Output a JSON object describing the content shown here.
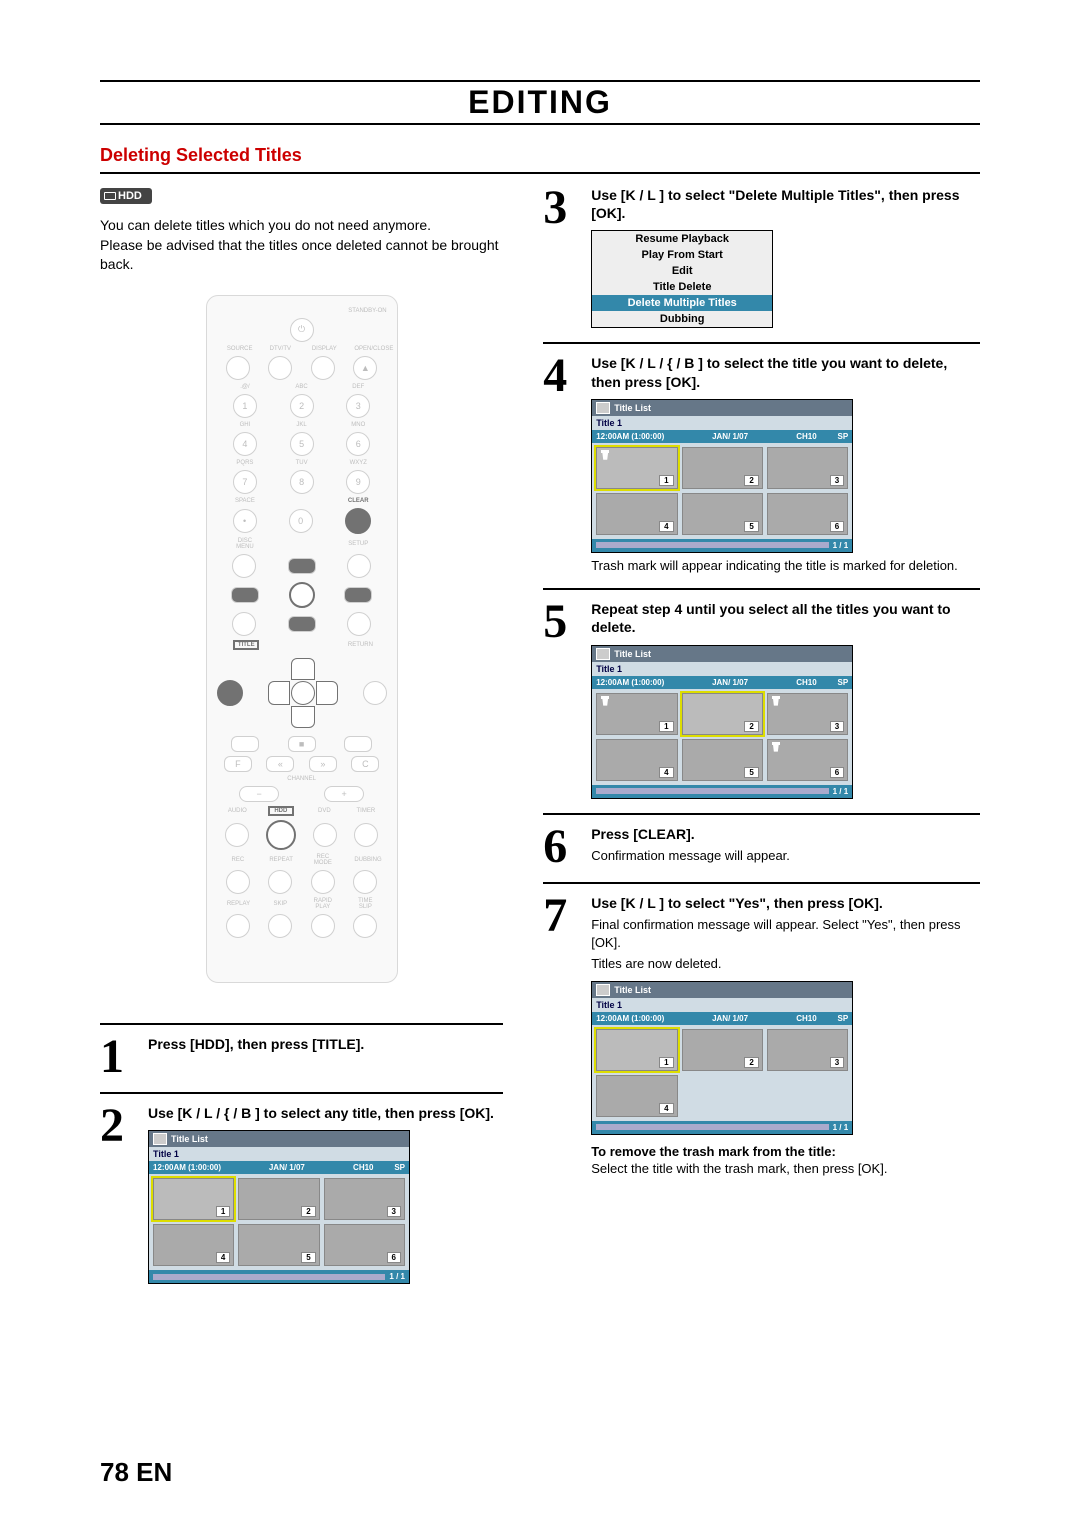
{
  "header": {
    "title": "EDITING"
  },
  "section": {
    "title": "Deleting Selected Titles"
  },
  "badge": {
    "hdd": "HDD"
  },
  "intro": {
    "p1": "You can delete titles which you do not need anymore.",
    "p2": "Please be advised that the titles once deleted cannot be brought back."
  },
  "remote": {
    "standby": "STANDBY-ON",
    "row2": [
      "SOURCE",
      "DTV/TV",
      "DISPLAY",
      "OPEN/CLOSE"
    ],
    "abc": [
      ".@/",
      "ABC",
      "DEF"
    ],
    "ghi": [
      "GHI",
      "JKL",
      "MNO"
    ],
    "pqrs": [
      "PQRS",
      "TUV",
      "WXYZ"
    ],
    "space_clear": [
      "SPACE",
      "CLEAR"
    ],
    "disc_setup": [
      "DISC MENU",
      "SETUP"
    ],
    "title_return": [
      "TITLE",
      "RETURN"
    ],
    "channel": "CHANNEL",
    "row_small": [
      "AUDIO",
      "HDD",
      "DVD",
      "TIMER"
    ],
    "row_small2": [
      "REC",
      "REPEAT",
      "REC MODE",
      "DUBBING"
    ],
    "row_small3": [
      "REPLAY",
      "SKIP",
      "RAPID PLAY",
      "TIME SLIP"
    ]
  },
  "steps": {
    "s1": {
      "num": "1",
      "lead": "Press [HDD], then press [TITLE]."
    },
    "s2": {
      "num": "2",
      "lead": "Use [K / L / { / B ] to select any title, then press [OK]."
    },
    "s3": {
      "num": "3",
      "lead": "Use [K / L ] to select \"Delete Multiple Titles\", then press [OK].",
      "menu": [
        "Resume Playback",
        "Play From Start",
        "Edit",
        "Title Delete",
        "Delete Multiple Titles",
        "Dubbing"
      ],
      "menu_selected": 4
    },
    "s4": {
      "num": "4",
      "lead": "Use [K / L / { / B ] to select the title you want to delete, then press [OK].",
      "note": "Trash mark will appear indicating the title is marked for deletion."
    },
    "s5": {
      "num": "5",
      "lead": "Repeat step 4 until you select all the titles you want to delete."
    },
    "s6": {
      "num": "6",
      "lead": "Press [CLEAR].",
      "sub": "Confirmation message will appear."
    },
    "s7": {
      "num": "7",
      "lead": "Use [K / L ] to select \"Yes\", then press [OK].",
      "sub1": "Final confirmation message will appear. Select \"Yes\", then press [OK].",
      "sub2": "Titles are now deleted.",
      "note_head": "To remove the trash mark from the title:",
      "note_body": "Select the title with the trash mark, then press [OK]."
    }
  },
  "titlelist": {
    "header": "Title List",
    "title": "Title 1",
    "time": "12:00AM (1:00:00)",
    "date": "JAN/ 1/07",
    "ch": "CH10",
    "sp": "SP",
    "page": "1 / 1"
  },
  "footer": {
    "page": "78",
    "lang": "EN"
  }
}
